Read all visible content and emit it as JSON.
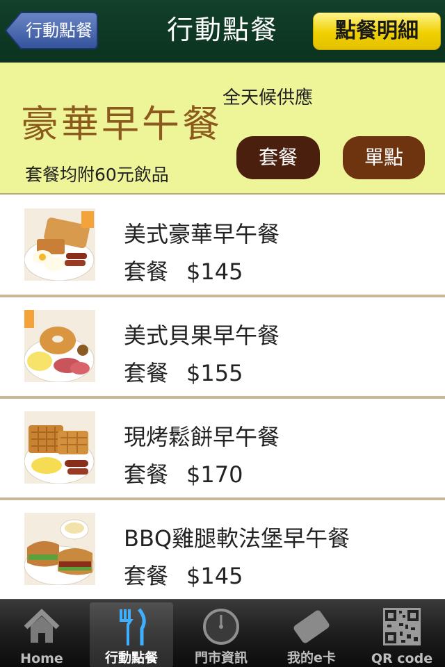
{
  "header": {
    "back_label": "行動點餐",
    "title": "行動點餐",
    "detail_label": "點餐明細"
  },
  "banner": {
    "title": "豪華早午餐",
    "availability": "全天候供應",
    "note": "套餐均附60元飲品",
    "set_button": "套餐",
    "single_button": "單點"
  },
  "menu": {
    "items": [
      {
        "name": "美式豪華早午餐",
        "type": "套餐",
        "price": "$145"
      },
      {
        "name": "美式貝果早午餐",
        "type": "套餐",
        "price": "$155"
      },
      {
        "name": "現烤鬆餅早午餐",
        "type": "套餐",
        "price": "$170"
      },
      {
        "name": "BBQ雞腿軟法堡早午餐",
        "type": "套餐",
        "price": "$145"
      }
    ]
  },
  "tabbar": {
    "tabs": [
      {
        "label": "Home",
        "icon": "house-icon"
      },
      {
        "label": "行動點餐",
        "icon": "fork-knife-icon",
        "active": true
      },
      {
        "label": "門市資訊",
        "icon": "clock-icon"
      },
      {
        "label": "我的e卡",
        "icon": "card-icon"
      },
      {
        "label": "QR code",
        "icon": "qr-code-icon"
      }
    ]
  },
  "colors": {
    "header_bg": "#0b331f",
    "banner_bg": "#eef498",
    "title_brown": "#8c5a1c",
    "pill_dark": "#4a1f0e",
    "detail_yellow": "#f0d000"
  }
}
